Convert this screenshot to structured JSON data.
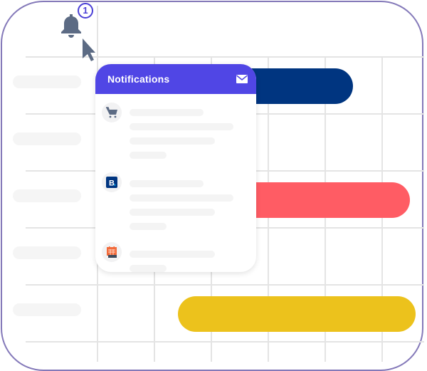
{
  "notification_bell": {
    "icon": "bell-icon",
    "badge_count": "1",
    "badge_color": "#4a3fd6"
  },
  "panel": {
    "title": "Notifications",
    "header_color": "#5046e5",
    "header_icon": "envelope-icon",
    "items": [
      {
        "icon": "shopping-cart-icon",
        "lines": 4
      },
      {
        "icon": "booking-b-logo-icon",
        "lines": 4
      },
      {
        "icon": "calendar-icon",
        "lines": 2
      }
    ]
  },
  "timeline": {
    "rows": 5,
    "columns": 6,
    "bars": [
      {
        "row": 1,
        "color": "#003580"
      },
      {
        "row": 3,
        "color": "#ff5c64"
      },
      {
        "row": 5,
        "color": "#ecc21c"
      }
    ]
  },
  "colors": {
    "frame_border": "#8479b9",
    "grid": "#e4e4e4",
    "placeholder": "#f5f5f5",
    "icon_gray": "#5c6b84"
  }
}
